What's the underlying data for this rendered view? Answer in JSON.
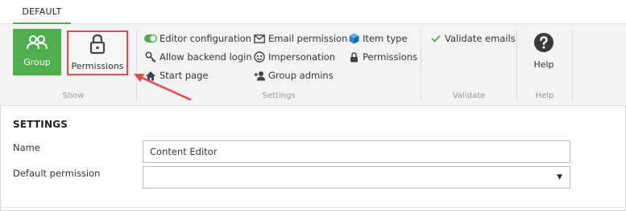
{
  "tabs": [
    {
      "label": "DEFAULT",
      "active": true
    }
  ],
  "ribbon": {
    "show": {
      "label": "Show",
      "group_button": "Group",
      "permissions_button": "Permissions"
    },
    "settings": {
      "label": "Settings",
      "items": [
        {
          "label": "Editor configuration",
          "icon": "toggle-on-icon"
        },
        {
          "label": "Allow backend login",
          "icon": "key-icon"
        },
        {
          "label": "Start page",
          "icon": "home-icon"
        },
        {
          "label": "Email permission",
          "icon": "envelope-icon"
        },
        {
          "label": "Impersonation",
          "icon": "mask-icon"
        },
        {
          "label": "Group admins",
          "icon": "user-plus-icon"
        },
        {
          "label": "Item type",
          "icon": "cube-icon"
        },
        {
          "label": "Permissions",
          "icon": "lock-icon"
        }
      ]
    },
    "validate": {
      "label": "Validate",
      "items": [
        {
          "label": "Validate emails",
          "icon": "check-icon"
        }
      ]
    },
    "help": {
      "label": "Help",
      "button": "Help"
    }
  },
  "settings_section": {
    "title": "SETTINGS",
    "name_label": "Name",
    "name_value": "Content Editor",
    "default_permission_label": "Default permission",
    "default_permission_value": ""
  },
  "colors": {
    "accent_green": "#4fae4e",
    "highlight_red": "#e14b4b",
    "ribbon_bg": "#f3f3f3"
  }
}
